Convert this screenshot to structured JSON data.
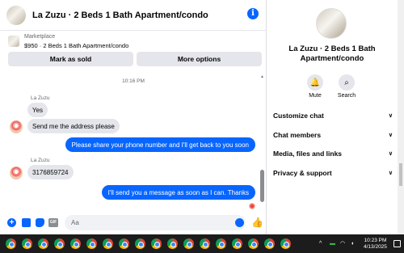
{
  "header": {
    "title": "La Zuzu · 2 Beds 1 Bath Apartment/condo",
    "info_icon": "info-icon"
  },
  "marketplace": {
    "label": "Marketplace",
    "item": "$950 · 2 Beds 1 Bath Apartment/condo"
  },
  "actions": {
    "mark_sold": "Mark as sold",
    "more_options": "More options"
  },
  "messages": {
    "timestamp": "10:16 PM",
    "items": [
      {
        "sender": "La Zuzu",
        "direction": "in",
        "text": "Yes"
      },
      {
        "direction": "in",
        "text": "Send me the address please"
      },
      {
        "direction": "out",
        "text": "Please share your phone number and I'll get back to you soon"
      },
      {
        "sender": "La Zuzu",
        "direction": "in",
        "text": "3176859724"
      },
      {
        "direction": "out",
        "text": "I'll send you a message as soon as I can. Thanks"
      }
    ]
  },
  "composer": {
    "placeholder": "Aa"
  },
  "sidebar": {
    "title": "La Zuzu · 2 Beds 1 Bath Apartment/condo",
    "quick_actions": [
      {
        "label": "Mute",
        "icon": "bell-icon"
      },
      {
        "label": "Search",
        "icon": "search-icon"
      }
    ],
    "sections": [
      "Customize chat",
      "Chat members",
      "Media, files and links",
      "Privacy & support"
    ]
  },
  "taskbar": {
    "time": "10:23 PM",
    "date": "4/13/2025"
  },
  "colors": {
    "accent": "#0866ff",
    "bubble_in": "#e4e6eb",
    "taskbar": "#1c1c1c"
  }
}
